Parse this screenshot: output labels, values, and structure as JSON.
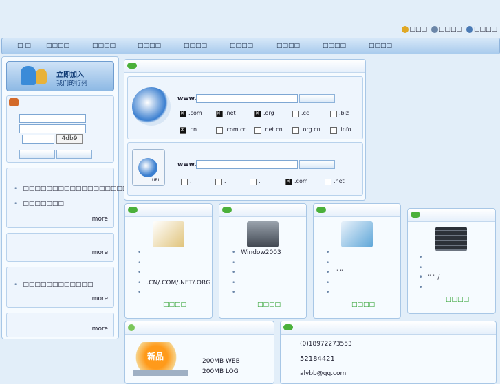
{
  "toplinks": [
    "□□□",
    "□□□□",
    "□□□□"
  ],
  "nav": [
    "□ □",
    "□□□□",
    "□□□□",
    "□□□□",
    "□□□□",
    "□□□□",
    "□□□□",
    "□□□□",
    "□□□□"
  ],
  "join_banner": {
    "title": "立即加入",
    "subtitle": "我们的行列"
  },
  "captcha": "4db9",
  "left_list1": [
    "□□□□□□□□□□□□□□□□□□□□□□",
    "□□□□□□□"
  ],
  "left_list3": [
    "□□□□□□□□□□□□"
  ],
  "more": "more",
  "domain": {
    "www": "www.",
    "exts_row1": [
      ".com",
      ".net",
      ".org",
      ".cc",
      ".biz"
    ],
    "checked_row1": [
      true,
      true,
      true,
      false,
      false
    ],
    "exts_row2": [
      ".cn",
      ".com.cn",
      ".net.cn",
      ".org.cn",
      ".info"
    ],
    "checked_row2": [
      true,
      false,
      false,
      false,
      false
    ],
    "exts_row3": [
      ".",
      ".",
      ".",
      ".com",
      ".net"
    ],
    "checked_row3": [
      false,
      false,
      false,
      true,
      false
    ],
    "url_label": "URL"
  },
  "cards": [
    {
      "items": [
        "",
        "",
        "",
        ".CN/.COM/.NET/.ORG",
        ""
      ],
      "link": "□□□□"
    },
    {
      "items": [
        "Window2003",
        "",
        "",
        "",
        ""
      ],
      "link": "□□□□"
    },
    {
      "items": [
        "",
        "",
        "\" \"",
        "",
        ""
      ],
      "link": "□□□□"
    },
    {
      "items": [
        "",
        "",
        "\" \" /",
        ""
      ],
      "link": "□□□□"
    }
  ],
  "promo": {
    "badge": "新品",
    "lines": [
      "200MB WEB",
      "200MB LOG"
    ]
  },
  "contact": [
    "(0)18972273553",
    "52184421",
    "alybb@qq.com"
  ]
}
